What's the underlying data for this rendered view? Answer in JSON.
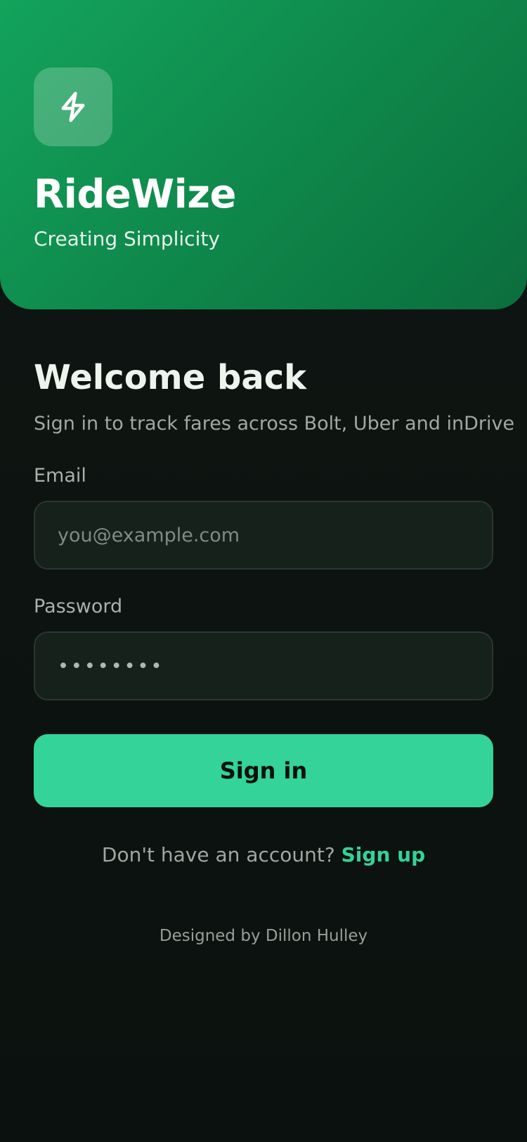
{
  "brand": {
    "name": "RideWize",
    "tagline": "Creating Simplicity",
    "logo_icon": "lightning-bolt-icon"
  },
  "welcome": {
    "title": "Welcome back",
    "subtitle": "Sign in to track fares across Bolt, Uber and inDrive"
  },
  "form": {
    "email_label": "Email",
    "email_value": "",
    "email_placeholder": "you@example.com",
    "password_label": "Password",
    "password_value": "••••••••"
  },
  "actions": {
    "sign_in_label": "Sign in",
    "no_account_text": "Don't have an account?",
    "sign_up_label": "Sign up"
  },
  "footer": {
    "credit": "Designed by Dillon Hulley"
  },
  "colors": {
    "hero_start": "#13a35b",
    "hero_end": "#0b6e3d",
    "background": "#0c120f",
    "input_background": "#16211b",
    "input_border": "#2b3630",
    "accent": "#33d399",
    "muted_text": "#9eaaa3"
  }
}
